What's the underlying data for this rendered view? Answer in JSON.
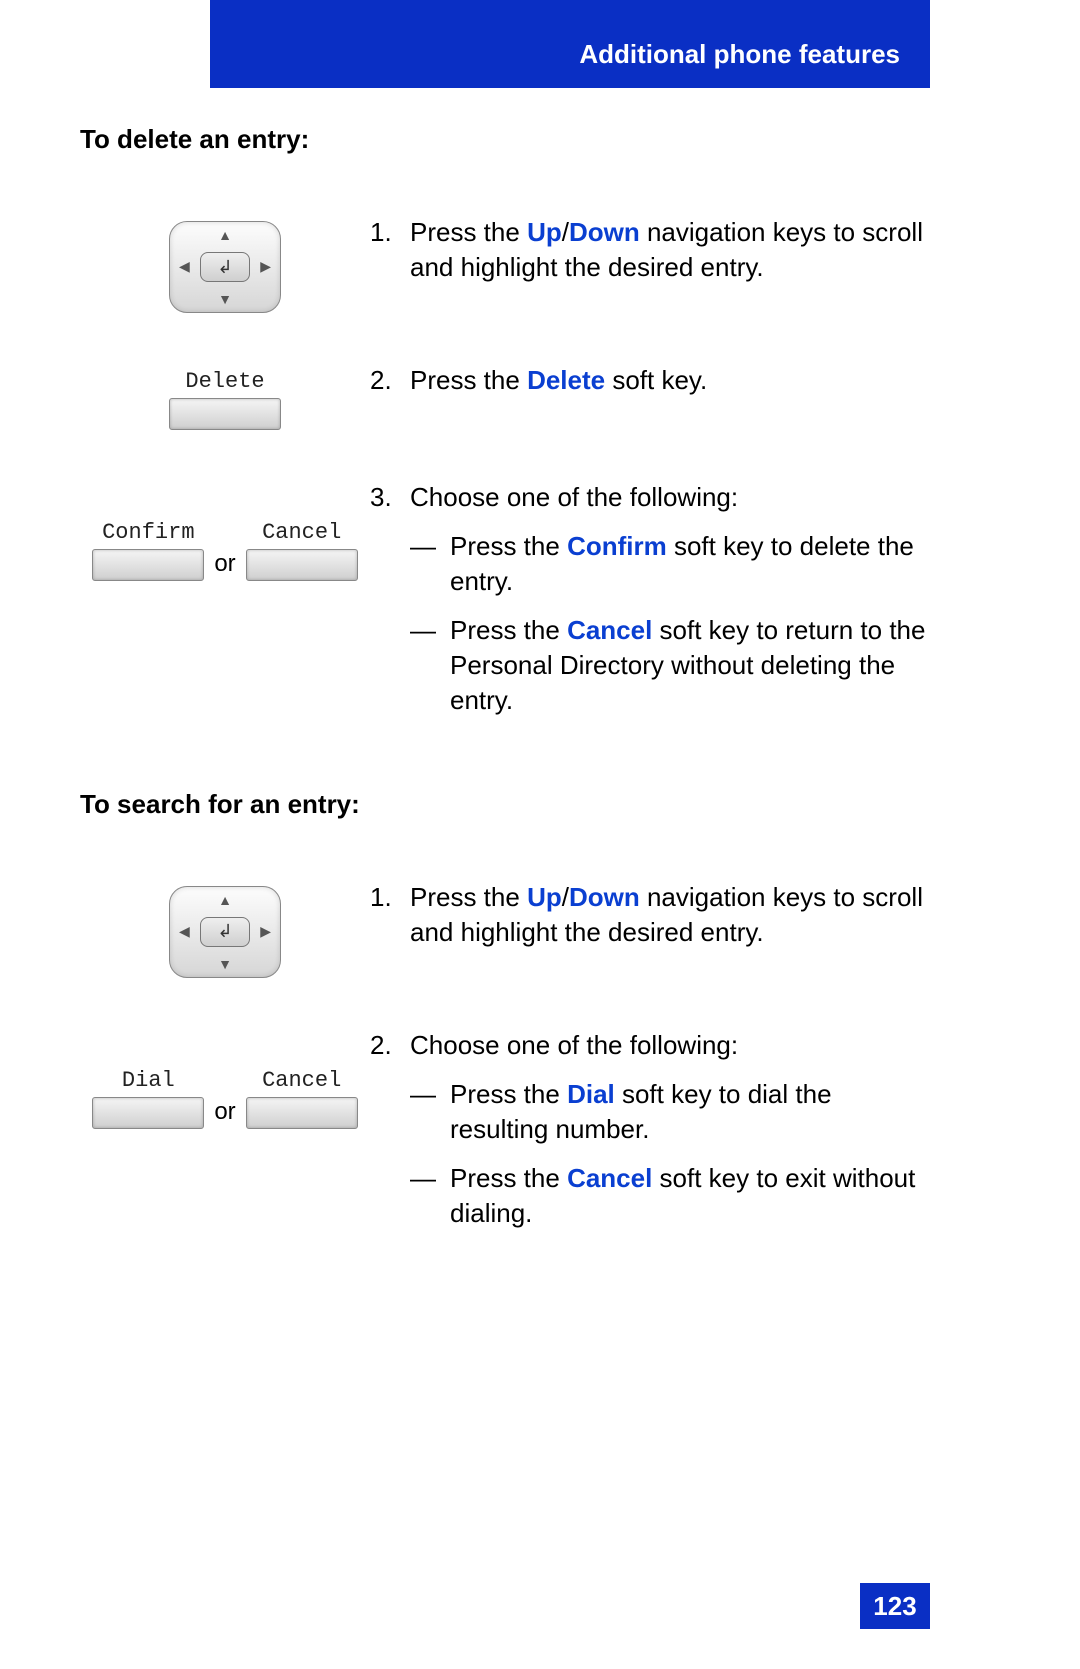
{
  "header": {
    "title": "Additional phone features"
  },
  "section1": {
    "title": "To delete an entry:",
    "softkeys": {
      "delete": "Delete",
      "confirm": "Confirm",
      "cancel": "Cancel",
      "or": "or"
    },
    "step1": {
      "num": "1.",
      "pre": "Press the ",
      "key1": "Up",
      "sep": "/",
      "key2": "Down",
      "post": " navigation keys to scroll and highlight the desired entry."
    },
    "step2": {
      "num": "2.",
      "pre": "Press the ",
      "key": "Delete",
      "post": " soft key."
    },
    "step3": {
      "num": "3.",
      "intro": "Choose one of the following:",
      "a_pre": "Press the ",
      "a_key": "Confirm",
      "a_post": " soft key to delete the entry.",
      "b_pre": "Press the ",
      "b_key": "Cancel",
      "b_post": " soft key to return to the Personal Directory without deleting the entry."
    }
  },
  "section2": {
    "title": "To search for an entry:",
    "softkeys": {
      "dial": "Dial",
      "cancel": "Cancel",
      "or": "or"
    },
    "step1": {
      "num": "1.",
      "pre": "Press the ",
      "key1": "Up",
      "sep": "/",
      "key2": "Down",
      "post": " navigation keys to scroll and highlight the desired entry."
    },
    "step2": {
      "num": "2.",
      "intro": "Choose one of the following:",
      "a_pre": "Press the ",
      "a_key": "Dial",
      "a_post": " soft key to dial the resulting number.",
      "b_pre": "Press the ",
      "b_key": "Cancel",
      "b_post": " soft key to exit without dialing."
    }
  },
  "glyphs": {
    "dash": "—",
    "enter": "↲"
  },
  "page": {
    "number": "123"
  }
}
